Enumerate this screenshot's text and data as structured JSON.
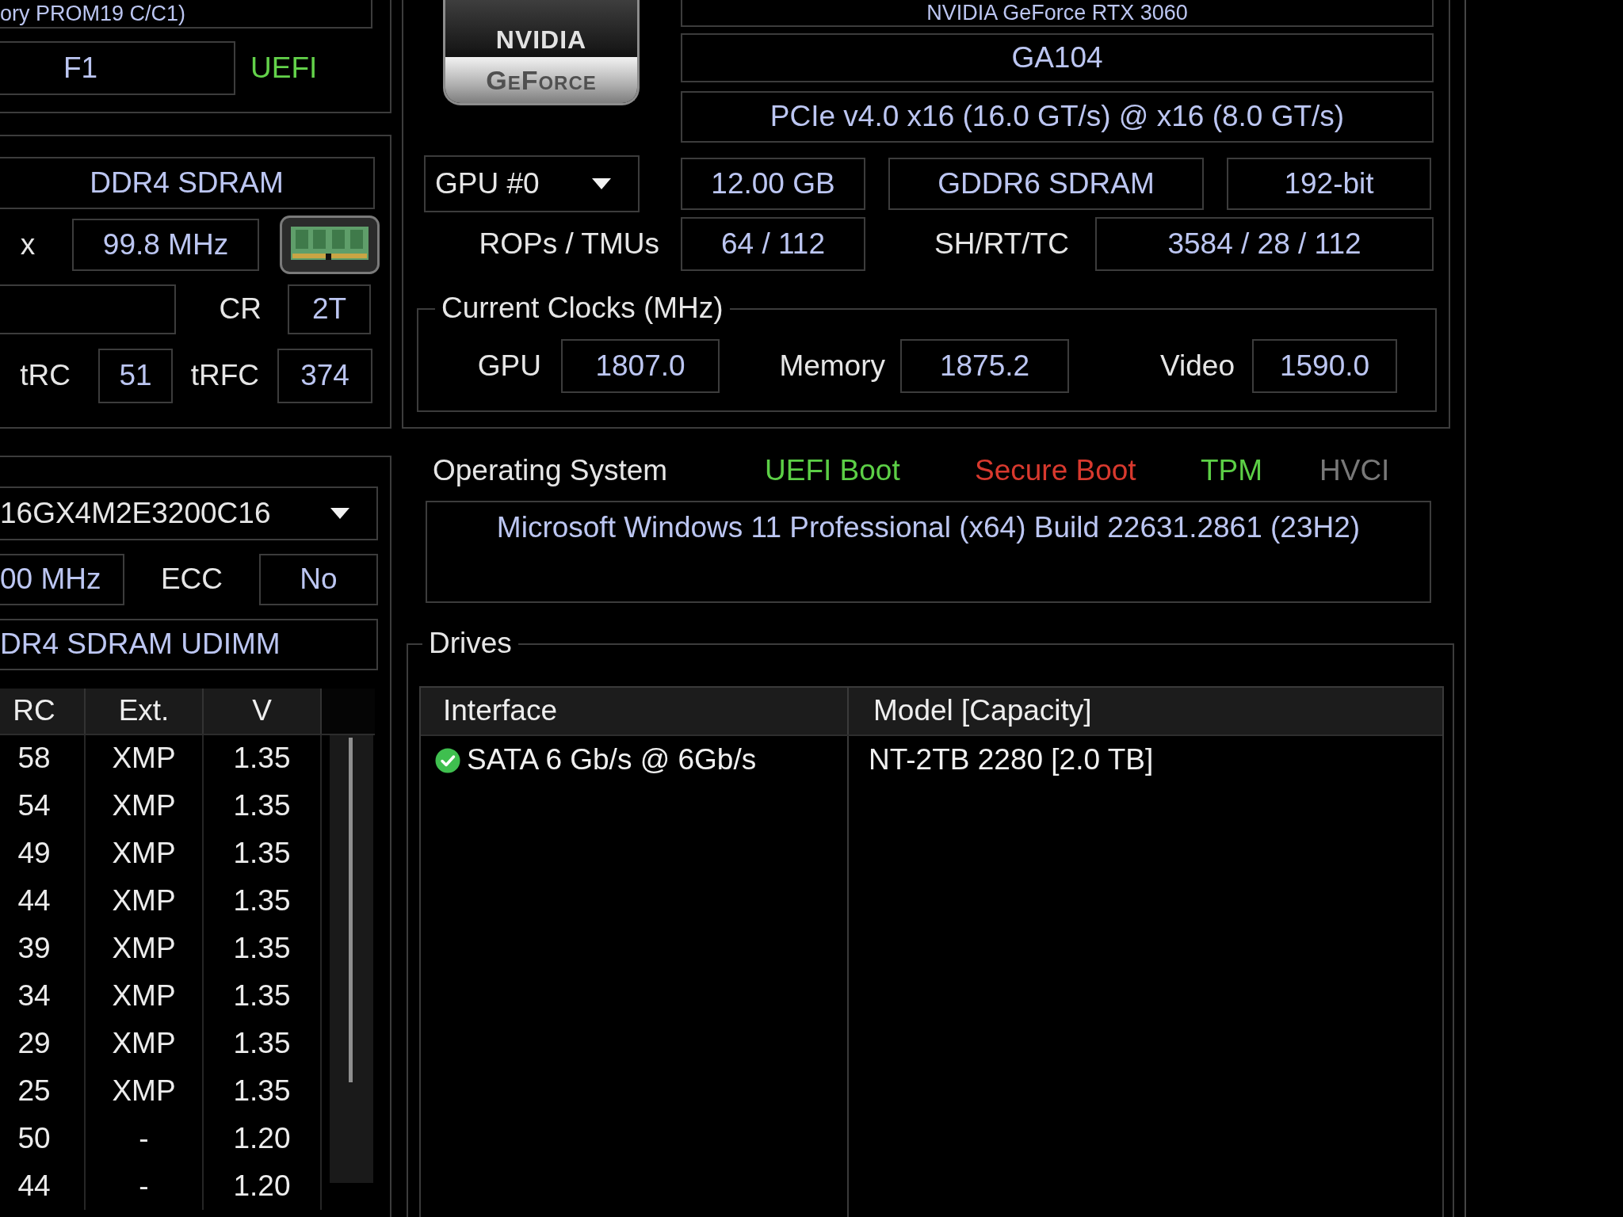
{
  "bios": {
    "top_field": "ory PROM19 C/C1)",
    "version": "F1",
    "uefi": {
      "label": "UEFI",
      "on": true
    }
  },
  "memory": {
    "type": "DDR4 SDRAM",
    "x_label": "x",
    "clock": "99.8 MHz",
    "cr_label": "CR",
    "cr": "2T",
    "trc_label": "tRC",
    "trc": "51",
    "trfc_label": "tRFC",
    "trfc": "374"
  },
  "module": {
    "part_number": "16GX4M2E3200C16",
    "speed": "00 MHz",
    "ecc_label": "ECC",
    "ecc": "No",
    "type": "DR4 SDRAM UDIMM",
    "table": {
      "columns": [
        "RC",
        "Ext.",
        "V"
      ],
      "rows": [
        [
          "58",
          "XMP",
          "1.35"
        ],
        [
          "54",
          "XMP",
          "1.35"
        ],
        [
          "49",
          "XMP",
          "1.35"
        ],
        [
          "44",
          "XMP",
          "1.35"
        ],
        [
          "39",
          "XMP",
          "1.35"
        ],
        [
          "34",
          "XMP",
          "1.35"
        ],
        [
          "29",
          "XMP",
          "1.35"
        ],
        [
          "25",
          "XMP",
          "1.35"
        ],
        [
          "50",
          "-",
          "1.20"
        ],
        [
          "44",
          "-",
          "1.20"
        ]
      ]
    }
  },
  "gpu": {
    "logo": {
      "top": "NVIDIA",
      "bottom": "GeForce"
    },
    "name": "NVIDIA GeForce RTX 3060",
    "chip": "GA104",
    "bus": "PCIe v4.0 x16 (16.0 GT/s) @ x16 (8.0 GT/s)",
    "selector": "GPU #0",
    "memory_size": "12.00 GB",
    "memory_type": "GDDR6 SDRAM",
    "bus_width": "192-bit",
    "rops_label": "ROPs / TMUs",
    "rops": "64 / 112",
    "shaders_label": "SH/RT/TC",
    "shaders": "3584 / 28 / 112",
    "clocks": {
      "title": "Current Clocks (MHz)",
      "items": [
        {
          "label": "GPU",
          "value": "1807.0"
        },
        {
          "label": "Memory",
          "value": "1875.2"
        },
        {
          "label": "Video",
          "value": "1590.0"
        }
      ]
    }
  },
  "os": {
    "label": "Operating System",
    "flags": [
      {
        "text": "UEFI Boot",
        "color": "#5ccf46"
      },
      {
        "text": "Secure Boot",
        "color": "#d8392e"
      },
      {
        "text": "TPM",
        "color": "#5ccf46"
      },
      {
        "text": "HVCI",
        "color": "#787878"
      }
    ],
    "name": "Microsoft Windows 11 Professional (x64) Build 22631.2861 (23H2)"
  },
  "drives": {
    "title": "Drives",
    "columns": [
      "Interface",
      "Model [Capacity]"
    ],
    "rows": [
      {
        "healthy": true,
        "interface": "SATA 6 Gb/s @ 6Gb/s",
        "model": "NT-2TB 2280 [2.0 TB]"
      }
    ]
  }
}
